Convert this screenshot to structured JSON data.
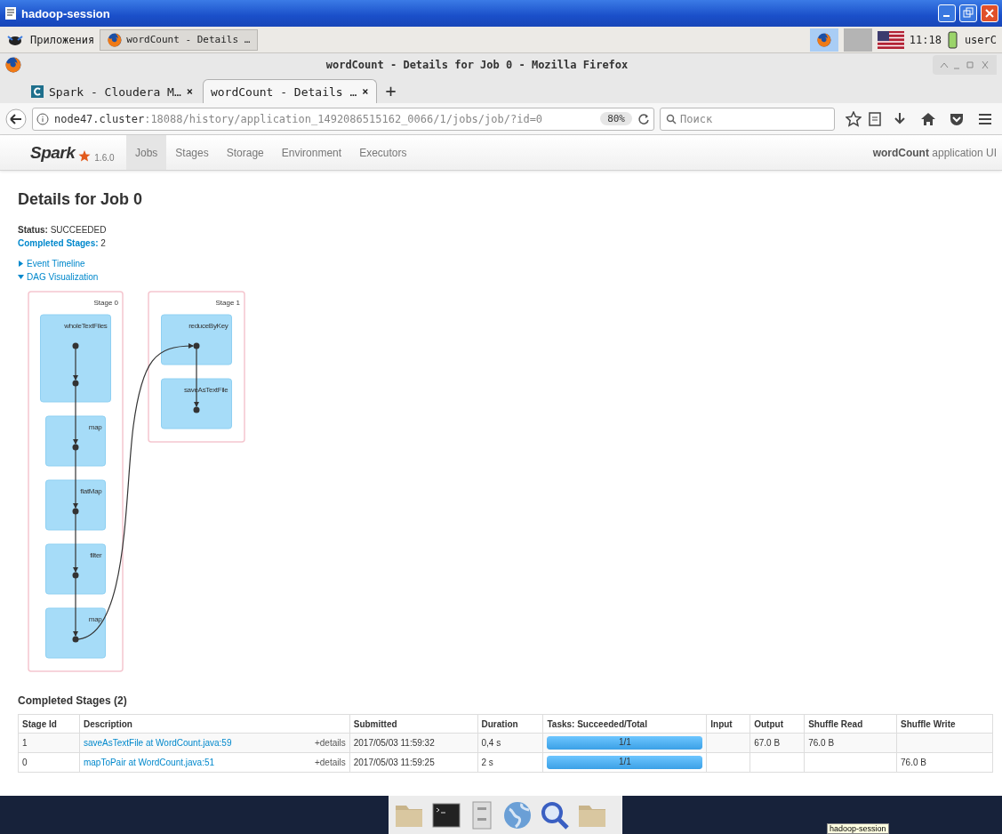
{
  "session_window": {
    "title": "hadoop-session"
  },
  "panel": {
    "apps_menu": "Приложения",
    "task": "wordCount - Details …",
    "clock": "11:18",
    "user": "userC"
  },
  "browser": {
    "title": "wordCount - Details for Job 0 - Mozilla Firefox",
    "tabs": [
      {
        "label": "Spark - Cloudera M…",
        "selected": false,
        "kind": "cloudera",
        "close": "×"
      },
      {
        "label": "wordCount - Details …",
        "selected": true,
        "kind": "page",
        "close": "×"
      }
    ],
    "new_tab": "+",
    "url": {
      "host": "node47.cluster",
      "path": ":18088/history/application_1492086515162_0066/1/jobs/job/?id=0"
    },
    "zoom": "80%",
    "search": {
      "placeholder": "Поиск"
    }
  },
  "spark_nav": {
    "logo": "Spark",
    "version": "1.6.0",
    "tabs": [
      {
        "label": "Jobs",
        "selected": true
      },
      {
        "label": "Stages",
        "selected": false
      },
      {
        "label": "Storage",
        "selected": false
      },
      {
        "label": "Environment",
        "selected": false
      },
      {
        "label": "Executors",
        "selected": false
      }
    ],
    "app_title": "**wordCount** application UI"
  },
  "page": {
    "heading": "Details for Job 0",
    "status": {
      "label": "Status:",
      "value": "SUCCEEDED"
    },
    "completed": {
      "label": "Completed Stages:",
      "value": "2"
    },
    "toggles": [
      {
        "label": "Event Timeline",
        "expanded": false
      },
      {
        "label": "DAG Visualization",
        "expanded": true
      }
    ],
    "dag": {
      "stages": [
        {
          "label": "Stage 0",
          "nodes": [
            "wholeTextFiles",
            "map",
            "flatMap",
            "filter",
            "map"
          ]
        },
        {
          "label": "Stage 1",
          "nodes": [
            "reduceByKey",
            "saveAsTextFile"
          ]
        }
      ]
    },
    "stages_heading": "Completed Stages (2)",
    "table": {
      "columns": [
        "Stage Id",
        "Description",
        "Submitted",
        "Duration",
        "Tasks: Succeeded/Total",
        "Input",
        "Output",
        "Shuffle Read",
        "Shuffle Write"
      ],
      "rows": [
        {
          "stage_id": "1",
          "description": "saveAsTextFile at WordCount.java:59",
          "details": "+details",
          "submitted": "2017/05/03 11:59:32",
          "duration": "0,4 s",
          "tasks": "1/1",
          "level": 1,
          "input": "",
          "output": "67.0 B",
          "shuffle_read": "76.0 B",
          "shuffle_write": ""
        },
        {
          "stage_id": "0",
          "description": "mapToPair at WordCount.java:51",
          "details": "+details",
          "submitted": "2017/05/03 11:59:25",
          "duration": "2 s",
          "tasks": "1/1",
          "level": 1,
          "input": "",
          "output": "",
          "shuffle_read": "",
          "shuffle_write": "76.0 B"
        }
      ]
    }
  },
  "dock": {
    "tooltip": "hadoop-session"
  }
}
